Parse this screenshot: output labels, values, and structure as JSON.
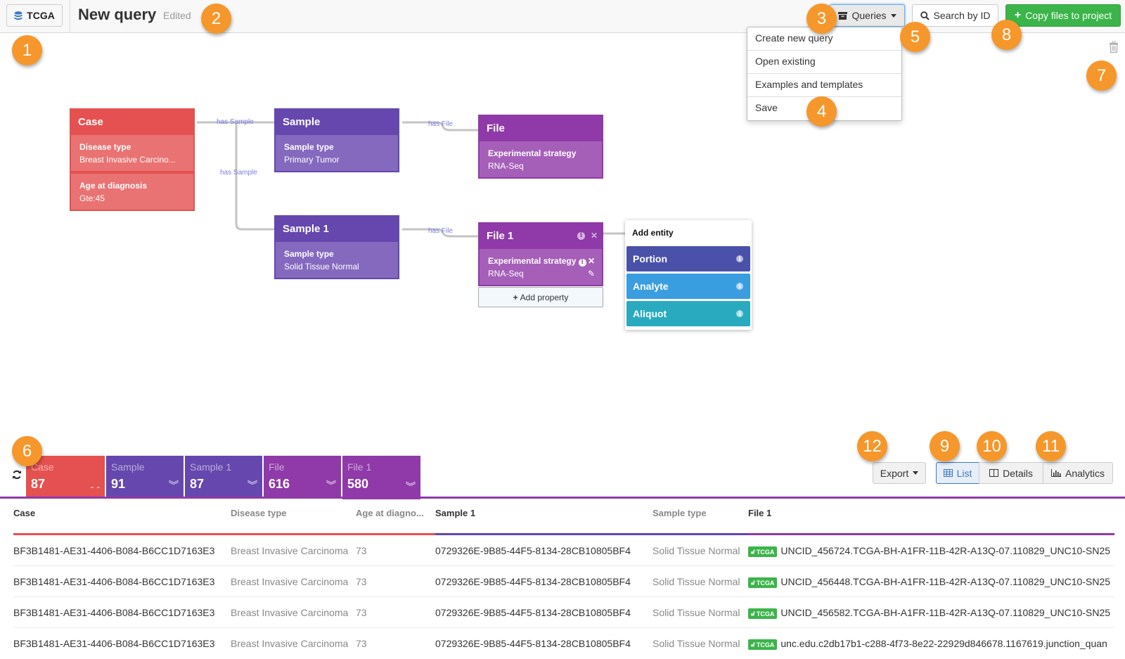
{
  "header": {
    "project_label": "TCGA",
    "title": "New query",
    "status": "Edited",
    "queries_label": "Queries",
    "search_label": "Search by ID",
    "copy_label": "Copy files to project"
  },
  "queries_menu": {
    "items": [
      "Create new query",
      "Open existing",
      "Examples and templates",
      "Save"
    ]
  },
  "graph": {
    "edges": [
      "has Sample",
      "has Sample",
      "has File",
      "has File"
    ],
    "nodes": {
      "case": {
        "title": "Case",
        "props": [
          {
            "name": "Disease type",
            "value": "Breast Invasive Carcino..."
          },
          {
            "name": "Age at diagnosis",
            "value": "Gte:45"
          }
        ]
      },
      "sample": {
        "title": "Sample",
        "props": [
          {
            "name": "Sample type",
            "value": "Primary Tumor"
          }
        ]
      },
      "file": {
        "title": "File",
        "props": [
          {
            "name": "Experimental strategy",
            "value": "RNA-Seq"
          }
        ]
      },
      "sample1": {
        "title": "Sample 1",
        "props": [
          {
            "name": "Sample type",
            "value": "Solid Tissue Normal"
          }
        ]
      },
      "file1": {
        "title": "File 1",
        "props": [
          {
            "name": "Experimental strategy",
            "value": "RNA-Seq"
          }
        ]
      }
    },
    "add_property_label": "Add property",
    "add_entity": {
      "title": "Add entity",
      "items": [
        {
          "label": "Portion",
          "color": "#4a51a8"
        },
        {
          "label": "Analyte",
          "color": "#3a9de0"
        },
        {
          "label": "Aliquot",
          "color": "#29aabf"
        }
      ]
    }
  },
  "callouts": [
    "1",
    "2",
    "3",
    "4",
    "5",
    "6",
    "7",
    "8",
    "9",
    "10",
    "11",
    "12"
  ],
  "counts": [
    {
      "label": "Case",
      "value": "87",
      "color": "#e55150",
      "chevron": "- -"
    },
    {
      "label": "Sample",
      "value": "91",
      "color": "#6547ae",
      "chevron": "⌄"
    },
    {
      "label": "Sample 1",
      "value": "87",
      "color": "#6547ae",
      "chevron": "⌄"
    },
    {
      "label": "File",
      "value": "616",
      "color": "#8f3aa8",
      "chevron": "⌄"
    },
    {
      "label": "File 1",
      "value": "580",
      "color": "#8f3aa8",
      "chevron": "⌄"
    }
  ],
  "view_controls": {
    "export_label": "Export",
    "list_label": "List",
    "details_label": "Details",
    "analytics_label": "Analytics"
  },
  "table": {
    "columns": [
      "Case",
      "Disease type",
      "Age at diagno...",
      "Sample 1",
      "Sample type",
      "File 1"
    ],
    "badge_label": "TCGA",
    "rows": [
      [
        "BF3B1481-AE31-4406-B084-B6CC1D7163E3",
        "Breast Invasive Carcinoma",
        "73",
        "0729326E-9B85-44F5-8134-28CB10805BF4",
        "Solid Tissue Normal",
        "UNCID_456724.TCGA-BH-A1FR-11B-42R-A13Q-07.110829_UNC10-SN25"
      ],
      [
        "BF3B1481-AE31-4406-B084-B6CC1D7163E3",
        "Breast Invasive Carcinoma",
        "73",
        "0729326E-9B85-44F5-8134-28CB10805BF4",
        "Solid Tissue Normal",
        "UNCID_456448.TCGA-BH-A1FR-11B-42R-A13Q-07.110829_UNC10-SN25"
      ],
      [
        "BF3B1481-AE31-4406-B084-B6CC1D7163E3",
        "Breast Invasive Carcinoma",
        "73",
        "0729326E-9B85-44F5-8134-28CB10805BF4",
        "Solid Tissue Normal",
        "UNCID_456582.TCGA-BH-A1FR-11B-42R-A13Q-07.110829_UNC10-SN25"
      ],
      [
        "BF3B1481-AE31-4406-B084-B6CC1D7163E3",
        "Breast Invasive Carcinoma",
        "73",
        "0729326E-9B85-44F5-8134-28CB10805BF4",
        "Solid Tissue Normal",
        "unc.edu.c2db17b1-c288-4f73-8e22-22929d846678.1167619.junction_quan"
      ]
    ]
  }
}
